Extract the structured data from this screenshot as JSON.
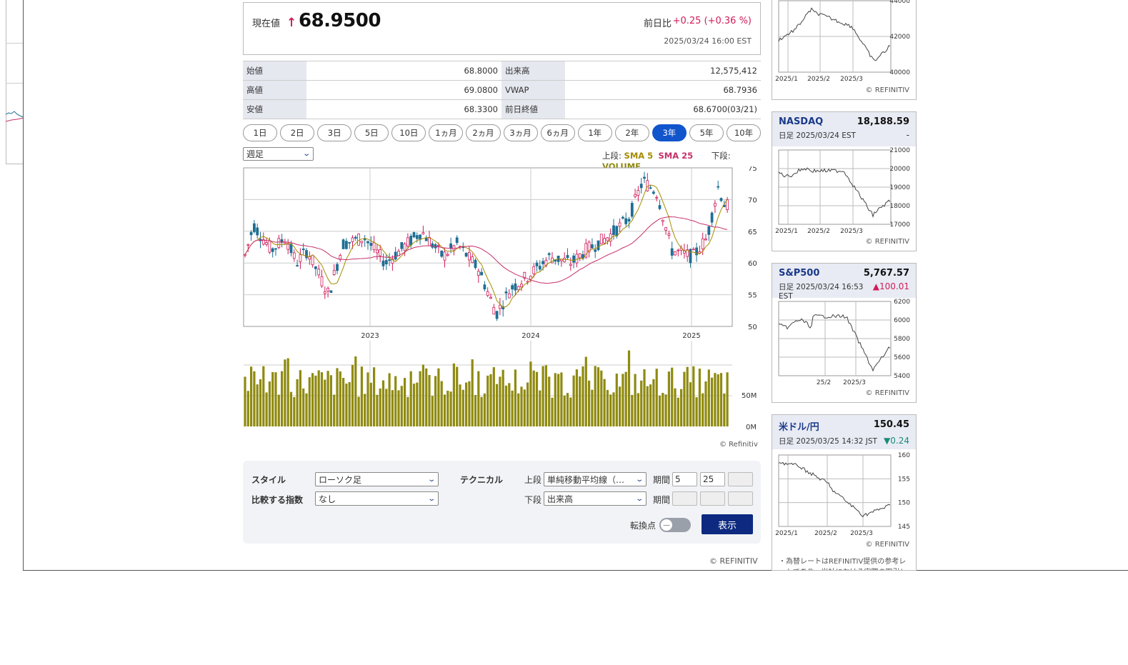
{
  "price": {
    "label": "現在値",
    "arrow": "↑",
    "value": "68.9500",
    "change_label": "前日比",
    "change_value": "+0.25 (+0.36 %)",
    "timestamp": "2025/03/24 16:00 EST"
  },
  "stats": [
    {
      "l1": "始値",
      "v1": "68.8000",
      "l2": "出来高",
      "v2": "12,575,412"
    },
    {
      "l1": "高値",
      "v1": "69.0800",
      "l2": "VWAP",
      "v2": "68.7936"
    },
    {
      "l1": "安値",
      "v1": "68.3300",
      "l2": "前日終値",
      "v2": "68.6700(03/21)"
    }
  ],
  "periods": [
    "1日",
    "2日",
    "3日",
    "5日",
    "10日",
    "1ヵ月",
    "2ヵ月",
    "3ヵ月",
    "6ヵ月",
    "1年",
    "2年",
    "3年",
    "5年",
    "10年"
  ],
  "active_period": "3年",
  "interval_select": "週足",
  "legend": {
    "upper_label": "上段:",
    "sma5": "SMA 5",
    "sma25": "SMA 25",
    "lower_label": "下段:",
    "volume": "VOLUME"
  },
  "colors": {
    "up": "#d01c5a",
    "down": "#1f6f94",
    "sma5": "#a48c00",
    "sma25": "#c5306a",
    "volume": "#8f8a10",
    "accent": "#1155cc"
  },
  "chart_data": {
    "type": "candlestick",
    "price_axis": {
      "ticks": [
        "75",
        "70",
        "65",
        "60",
        "55",
        "50"
      ],
      "ylim": [
        50,
        75
      ]
    },
    "x_ticks": [
      "2023",
      "2024",
      "2025"
    ],
    "volume_axis": {
      "ticks": [
        "50M",
        "0M"
      ]
    },
    "copyright": "© Refinitiv"
  },
  "controls": {
    "style_label": "スタイル",
    "style_value": "ローソク足",
    "compare_label": "比較する指数",
    "compare_value": "なし",
    "technical_label": "テクニカル",
    "upper_label": "上段",
    "upper_value": "単純移動平均線（…",
    "lower_label": "下段",
    "lower_value": "出来高",
    "period_label": "期間",
    "period1": "5",
    "period2": "25",
    "pivot_label": "転換点",
    "show_button": "表示"
  },
  "footer_copy": "© REFINITIV",
  "cards": [
    {
      "name": "",
      "value": "",
      "date": "",
      "change": "",
      "y_ticks": [
        "44000",
        "42000",
        "40000"
      ],
      "x_ticks": [
        "2025/1",
        "2025/2",
        "2025/3"
      ],
      "copy": "© REFINITIV"
    },
    {
      "name": "NASDAQ",
      "value": "18,188.59",
      "date": "日足 2025/03/24 EST",
      "change": "-",
      "y_ticks": [
        "21000",
        "20000",
        "19000",
        "18000",
        "17000"
      ],
      "x_ticks": [
        "2025/1",
        "2025/2",
        "2025/3"
      ],
      "copy": "© REFINITIV"
    },
    {
      "name": "S&P500",
      "value": "5,767.57",
      "date": "日足 2025/03/24 16:53 EST",
      "change": "▲100.01",
      "y_ticks": [
        "6200",
        "6000",
        "5800",
        "5600",
        "5400"
      ],
      "x_ticks": [
        "25/2",
        "2025/3"
      ],
      "copy": "© REFINITIV"
    },
    {
      "name": "米ドル/円",
      "value": "150.45",
      "date": "日足 2025/03/25 14:32 JST",
      "change": "▼0.24",
      "y_ticks": [
        "160",
        "155",
        "150",
        "145"
      ],
      "x_ticks": [
        "2025/1",
        "2025/2",
        "2025/3"
      ],
      "copy": "© REFINITIV"
    }
  ],
  "note": "・為替レートはREFINITIV提供の参考レートであり、当社における実際の取引レ"
}
